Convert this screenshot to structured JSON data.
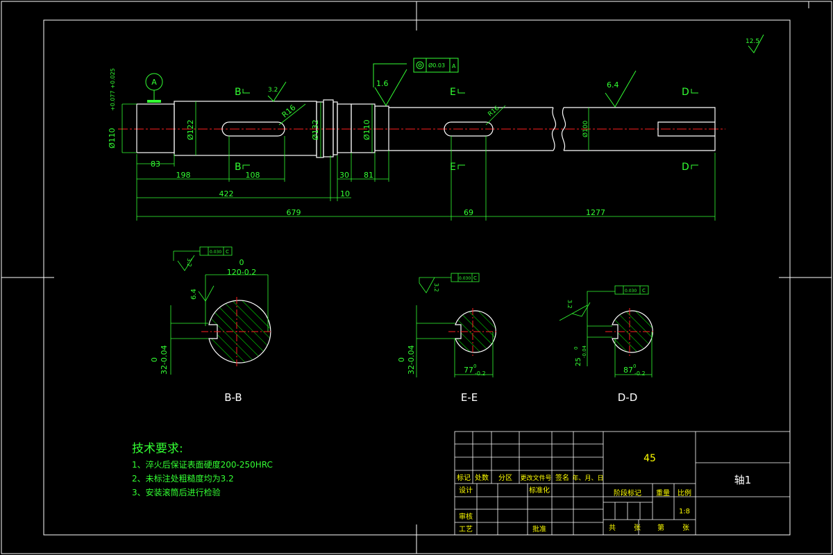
{
  "main_view": {
    "datum_label": "A",
    "dims": {
      "d_left": "Ø110",
      "d_left_tol": "+0.077 +0.025",
      "d_122": "Ø122",
      "d_132": "Ø132",
      "d_110": "Ø110",
      "d_100": "Ø100",
      "r16_a": "R16",
      "r16_b": "R16",
      "len_83": "83",
      "len_198": "198",
      "len_108": "108",
      "len_422": "422",
      "len_30": "30",
      "len_81": "81",
      "len_10": "10",
      "len_679": "679",
      "len_69": "69",
      "len_1277": "1277"
    },
    "section_marks": {
      "b": "B",
      "e": "E",
      "d": "D"
    },
    "roughness": {
      "r_3_2": "3.2",
      "r_1_6": "1.6",
      "r_6_4": "6.4",
      "r_12_5": "12.5"
    },
    "tolerance_frame": {
      "value": "Ø0.03",
      "datum": "A"
    }
  },
  "sections": [
    {
      "title": "B-B",
      "width_dim": "120-0.2",
      "width_upper": "0",
      "key_dim": "32-0.04",
      "key_upper": "0",
      "roughness_a": "3.2",
      "roughness_b": "6.4",
      "frame": "0.030",
      "frame_datum": "C"
    },
    {
      "title": "E-E",
      "width_dim": "77",
      "width_tol_upper": "0",
      "width_tol_lower": "-0.2",
      "key_dim": "32-0.04",
      "key_upper": "0",
      "roughness_a": "3.2",
      "frame": "0.030",
      "frame_datum": "C"
    },
    {
      "title": "D-D",
      "width_dim": "87",
      "width_tol_upper": "0",
      "width_tol_lower": "-0.2",
      "key_dim": "25",
      "key_tol": "-0.04",
      "key_upper": "0",
      "roughness_a": "3.2",
      "frame": "0.030",
      "frame_datum": "C"
    }
  ],
  "tech_requirements": {
    "heading": "技术要求:",
    "items": [
      "1、淬火后保证表面硬度200-250HRC",
      "2、未标注处粗糙度均为3.2",
      "3、安装滚筒后进行检验"
    ]
  },
  "title_block": {
    "material": "45",
    "part_name": "轴1",
    "scale": "1:8",
    "labels": {
      "biaoji": "标记",
      "chushu": "处数",
      "fenqu": "分区",
      "gengai": "更改文件号",
      "qianming": "签名",
      "date": "年、月、日",
      "sheji": "设计",
      "biaozhunhua": "标准化",
      "jieduan": "阶段标记",
      "zhongliang": "重量",
      "bili": "比例",
      "shenhe": "审核",
      "gongyi": "工艺",
      "pizhun": "批准",
      "gong": "共",
      "zhang1": "张",
      "di": "第",
      "zhang2": "张"
    }
  },
  "colors": {
    "background": "#000000",
    "border": "#ffffff",
    "dimension": "#33ff33",
    "centerline": "#ff2020",
    "text_yellow": "#ffff00"
  }
}
